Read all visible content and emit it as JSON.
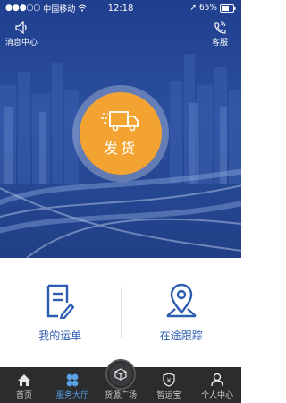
{
  "status_bar": {
    "carrier": "中国移动",
    "time": "12:18",
    "battery": "65%"
  },
  "header": {
    "messages_label": "消息中心",
    "service_label": "客服"
  },
  "hero": {
    "ship_label": "发货"
  },
  "cards": [
    {
      "label": "我的运单"
    },
    {
      "label": "在途跟踪"
    }
  ],
  "tabbar": {
    "active_color": "#5aa0e6",
    "items": [
      {
        "label": "首页",
        "icon": "home-icon"
      },
      {
        "label": "服务大厅",
        "icon": "clover-icon"
      },
      {
        "label": "货源广场",
        "icon": "box-icon"
      },
      {
        "label": "智运宝",
        "icon": "shield-icon"
      },
      {
        "label": "个人中心",
        "icon": "person-icon"
      }
    ]
  }
}
